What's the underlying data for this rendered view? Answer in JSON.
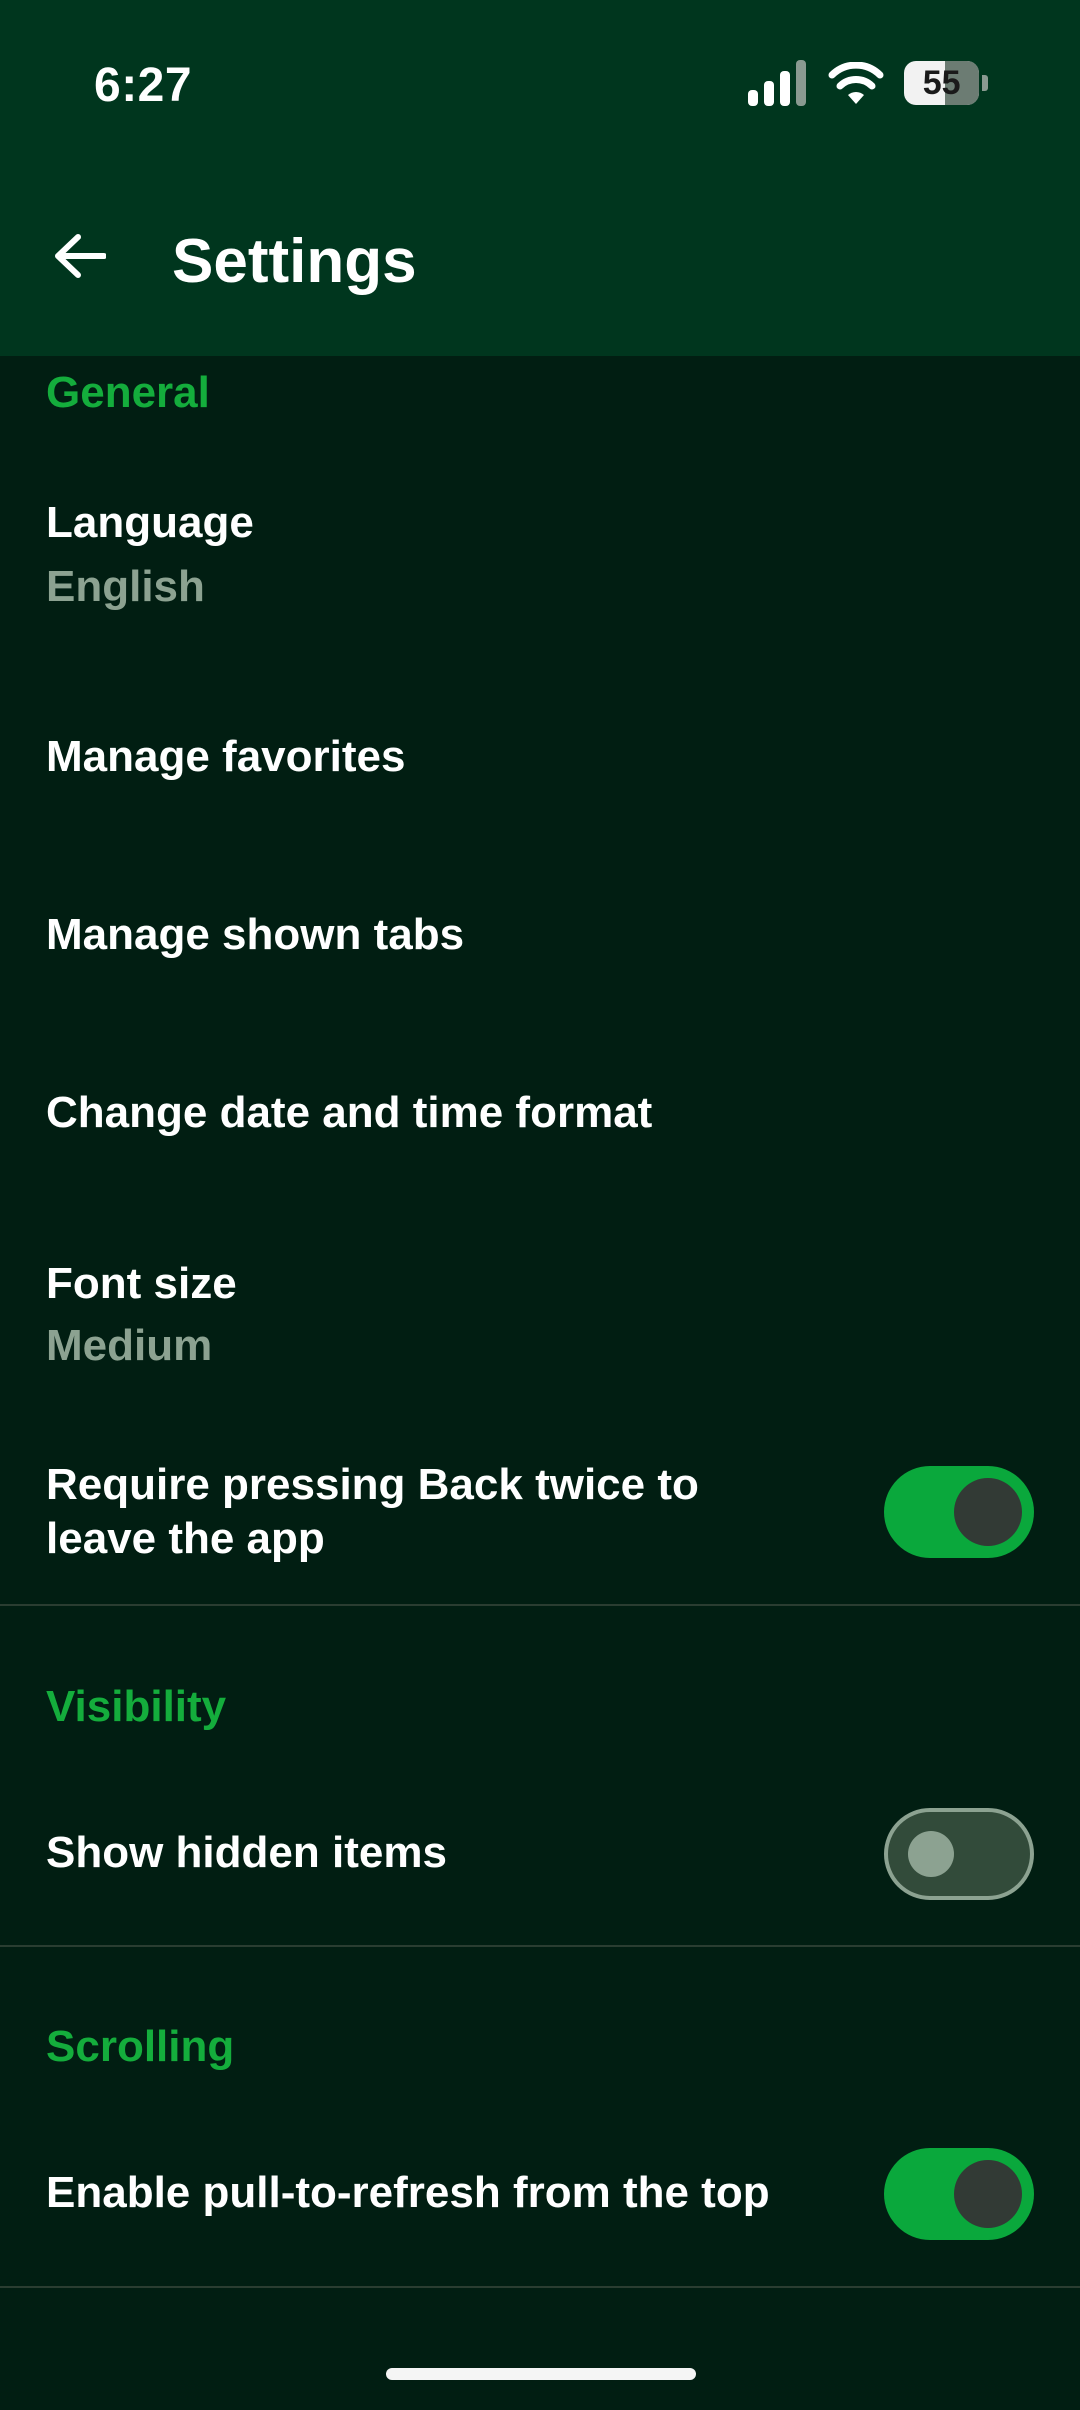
{
  "status_bar": {
    "time": "6:27",
    "battery": "55",
    "battery_level": 0.55
  },
  "header": {
    "title": "Settings"
  },
  "sections": {
    "general": {
      "header": "General",
      "language": {
        "title": "Language",
        "value": "English"
      },
      "manage_favorites": {
        "title": "Manage favorites"
      },
      "manage_tabs": {
        "title": "Manage shown tabs"
      },
      "date_format": {
        "title": "Change date and time format"
      },
      "font_size": {
        "title": "Font size",
        "value": "Medium"
      },
      "back_twice": {
        "title_line1": "Require pressing Back twice to",
        "title_line2": "leave the app",
        "enabled": true
      }
    },
    "visibility": {
      "header": "Visibility",
      "show_hidden": {
        "title": "Show hidden items",
        "enabled": false
      }
    },
    "scrolling": {
      "header": "Scrolling",
      "pull_refresh": {
        "title": "Enable pull-to-refresh from the top",
        "enabled": true
      }
    }
  },
  "colors": {
    "app_bar": "#00361e",
    "background": "#011e12",
    "accent": "#14ad3c",
    "toggle_on": "#0aa83c",
    "subtitle": "#8ca291"
  },
  "icons": {
    "back": "arrow-left-icon",
    "signal": "cellular-signal-icon",
    "wifi": "wifi-icon",
    "battery": "battery-icon"
  }
}
